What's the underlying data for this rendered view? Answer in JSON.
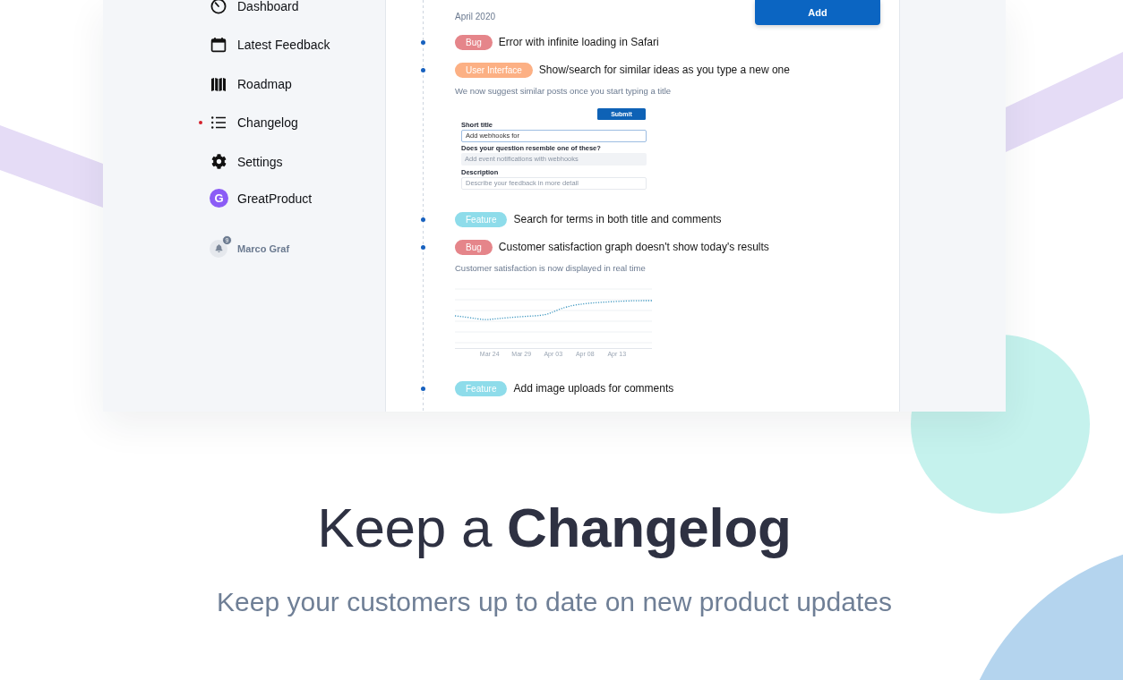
{
  "sidebar": {
    "items": [
      {
        "label": "Dashboard",
        "selected": false
      },
      {
        "label": "Latest Feedback",
        "selected": false
      },
      {
        "label": "Roadmap",
        "selected": false
      },
      {
        "label": "Changelog",
        "selected": true
      },
      {
        "label": "Settings",
        "selected": false
      }
    ],
    "workspace": {
      "logo": "G",
      "name": "GreatProduct"
    },
    "user": {
      "name": "Marco Graf",
      "notifications": "9"
    }
  },
  "changelog": {
    "month": "April 2020",
    "add_button": "Add",
    "entries": [
      {
        "tag": "Bug",
        "color": "#e5858a",
        "title": "Error with infinite loading in Safari"
      },
      {
        "tag": "User Interface",
        "color": "#fcb084",
        "title": "Show/search for similar ideas as you type a new one",
        "description": "We now suggest similar posts once you start typing a title",
        "attachment": {
          "kind": "form",
          "submit": "Submit",
          "title_label": "Short title",
          "title_value": "Add webhooks for",
          "similar_label": "Does your question resemble one of these?",
          "similar_item": "Add event notifications with webhooks",
          "description_label": "Description",
          "description_placeholder": "Describe your feedback in more detail"
        }
      },
      {
        "tag": "Feature",
        "color": "#8edcea",
        "title": "Search for terms in both title and comments"
      },
      {
        "tag": "Bug",
        "color": "#e5858a",
        "title": "Customer satisfaction graph doesn't show today's results",
        "description": "Customer satisfaction is now displayed in real time",
        "attachment": {
          "kind": "chart",
          "x_labels": [
            "Mar 24",
            "Mar 29",
            "Apr 03",
            "Apr 08",
            "Apr 13"
          ]
        }
      },
      {
        "tag": "Feature",
        "color": "#8edcea",
        "title": "Add image uploads for comments"
      }
    ]
  },
  "headline": "Keep a **Changelog**",
  "subheadline": "Keep your customers up to date on new product updates"
}
